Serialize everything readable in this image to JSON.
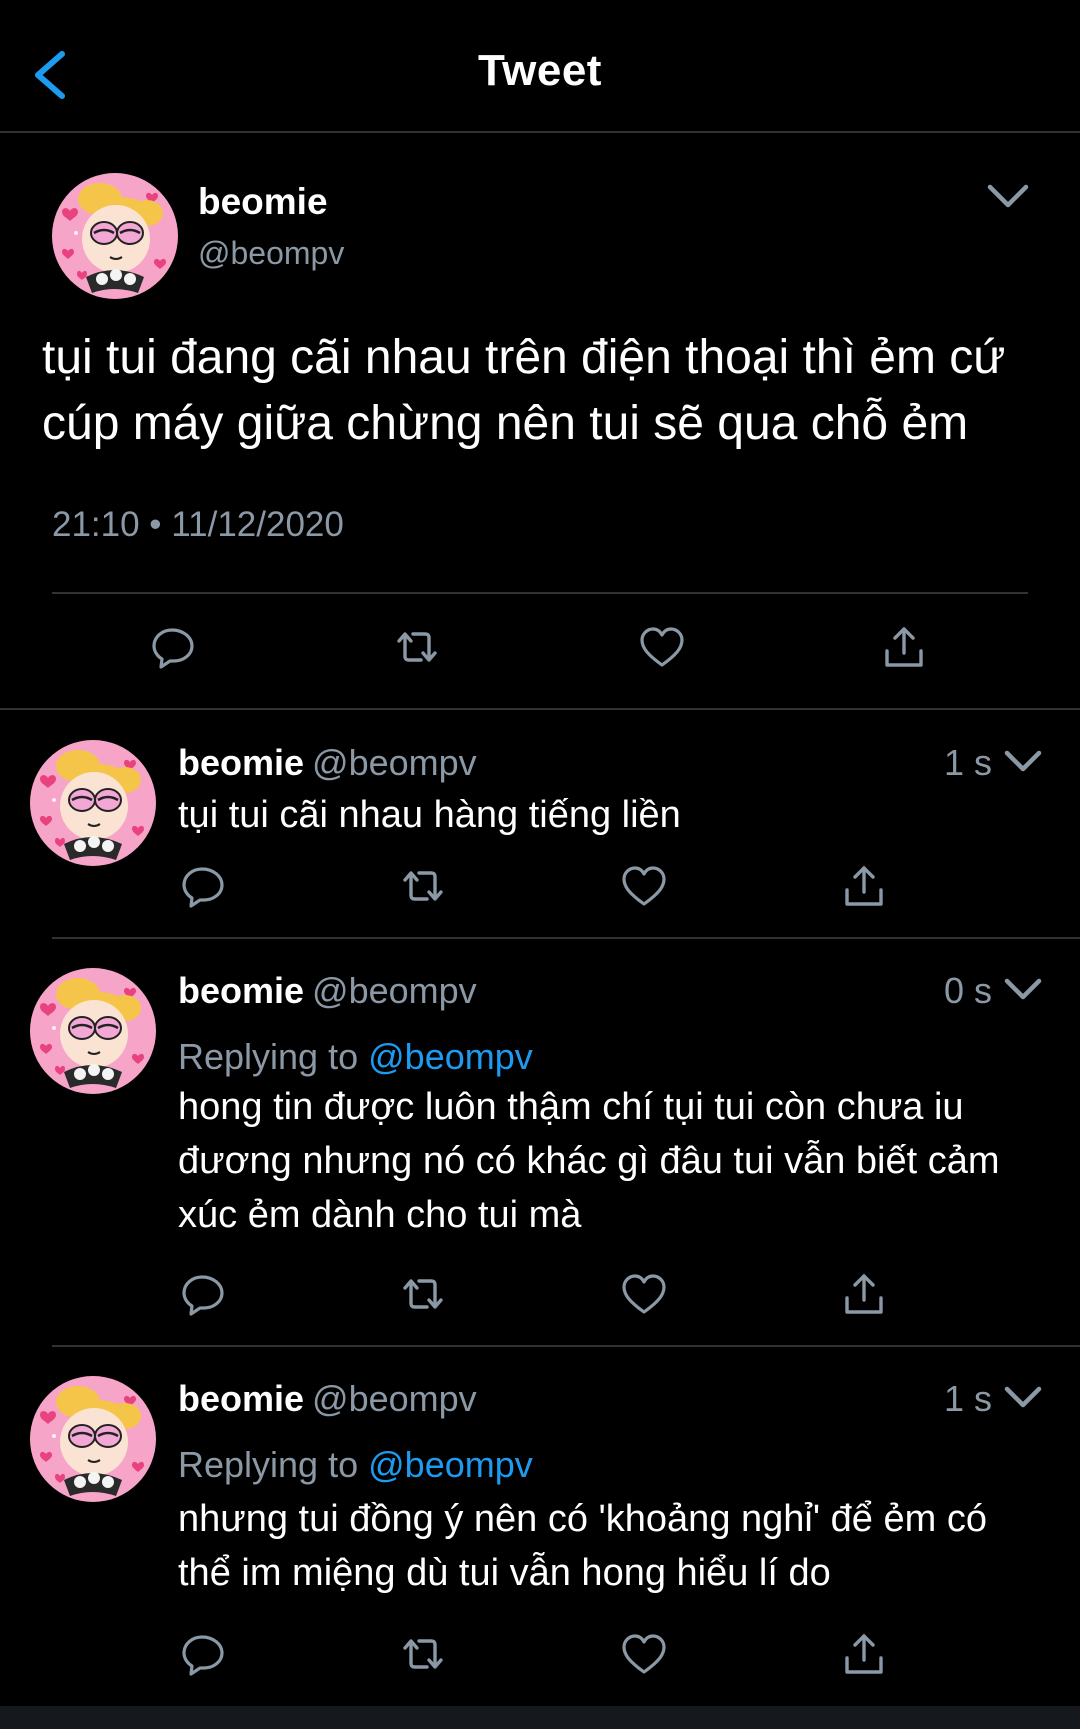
{
  "header": {
    "title": "Tweet"
  },
  "main_tweet": {
    "author_name": "beomie",
    "author_handle": "@beompv",
    "text": "tụi tui đang cãi nhau trên điện thoại thì ẻm cứ cúp máy giữa chừng nên tui sẽ qua chỗ ẻm",
    "timestamp": "21:10 • 11/12/2020",
    "actions": [
      "reply-icon",
      "retweet-icon",
      "like-icon",
      "share-icon"
    ]
  },
  "replies": [
    {
      "author_name": "beomie",
      "author_handle": "@beompv",
      "time": "1 s",
      "replying_label": "",
      "replying_to": "",
      "text": "tụi tui cãi nhau hàng tiếng liền"
    },
    {
      "author_name": "beomie",
      "author_handle": "@beompv",
      "time": "0 s",
      "replying_label": "Replying to",
      "replying_to": "@beompv",
      "text": "hong tin được luôn thậm chí tụi tui còn chưa iu đương nhưng nó có khác gì đâu tui vẫn biết cảm xúc ẻm dành cho tui mà"
    },
    {
      "author_name": "beomie",
      "author_handle": "@beompv",
      "time": "1 s",
      "replying_label": "Replying to",
      "replying_to": "@beompv",
      "text": "nhưng tui đồng ý nên có 'khoảng nghỉ' để ẻm có thể im miệng dù tui vẫn hong hiểu lí do"
    }
  ],
  "colors": {
    "background": "#000000",
    "secondary_text": "#8b98a5",
    "link": "#1d9bf0",
    "divider": "#2f3336",
    "avatar_bg": "#f6a4c8"
  }
}
